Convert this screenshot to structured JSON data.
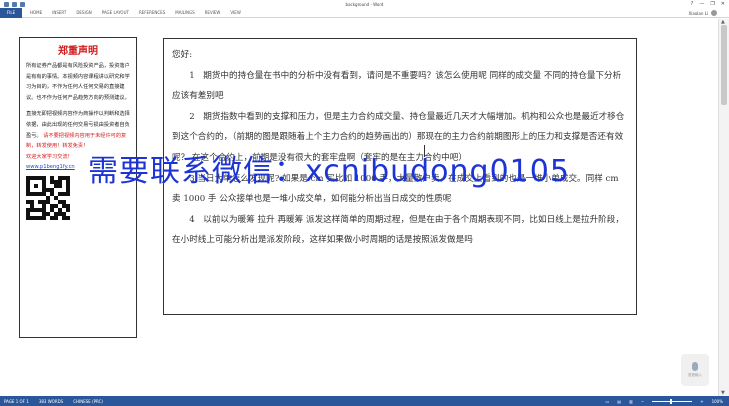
{
  "window": {
    "title": "background - Word",
    "controls": [
      "?",
      "—",
      "❐",
      "✕"
    ]
  },
  "ribbon": {
    "file_tab": "FILE",
    "tabs": [
      "HOME",
      "INSERT",
      "DESIGN",
      "PAGE LAYOUT",
      "REFERENCES",
      "MAILINGS",
      "REVIEW",
      "VIEW"
    ],
    "user_name": "Xiaolan Li"
  },
  "disclaimer": {
    "title": "郑重声明",
    "body": "所有证券产品都是有风险投资产品，投资落户是有有的事情。本视频内容课程讲以研究和学习为目的，不作为任何人任何交易的直接建议。也不作为任何产品趋势方向的预测建议。",
    "body2": "直接无即把视频内容作为商操作以判断和选择依据，由此出现的任何交易亏损由投资者自负盈亏。",
    "red_text": "请不要把视频内容用于未经许可的复制，转发使用！转发免责！",
    "red_text2": "欢迎大家学习交流！",
    "link": "www.p1beng1fy.cn"
  },
  "content": {
    "greeting": "您好:",
    "q1": "1　期货中的持仓量在书中的分析中没有看到，请问是不重要吗？该怎么使用呢 同样的成交量 不同的持仓量下分析应该有差别吧",
    "q2": "2　期货指数中看到的支撑和压力，但是主力合约成交量、持仓量最近几天才大幅增加。机构和公众也是最近才移仓到这个合约的，（前期的图是跟随着上个主力合约的趋势画出的）那现在的主力合约前期图形上的压力和支撑是否还有效呢？ 在这个合约上，前期是没有很大的套牢盘啊（套牢的是在主力合约中吧）",
    "q3": "3 当日大单怎么发现呢? 如果是 cm 买比如 1000 手，大量散户卖，在成交上看到的也是一堆小单成交。同样 cm 卖 1000 手 公众接单也是一堆小成交单，如何能分析出当日成交的性质呢",
    "q4": "4　以前以为暖筹 拉升 再暖筹 派发这样简单的周期过程，但是在由于各个周期表现不同，比如日线上是拉升阶段，在小时线上可能分析出是派发阶段，这样如果做小时周期的话是按照派发做是吗"
  },
  "watermark": "需要联系微信：xcnibudong0105",
  "mic": {
    "label": "语音输入"
  },
  "statusbar": {
    "page": "PAGE 1 OF 1",
    "words": "383 WORDS",
    "language": "CHINESE (PRC)",
    "zoom": "100%"
  }
}
